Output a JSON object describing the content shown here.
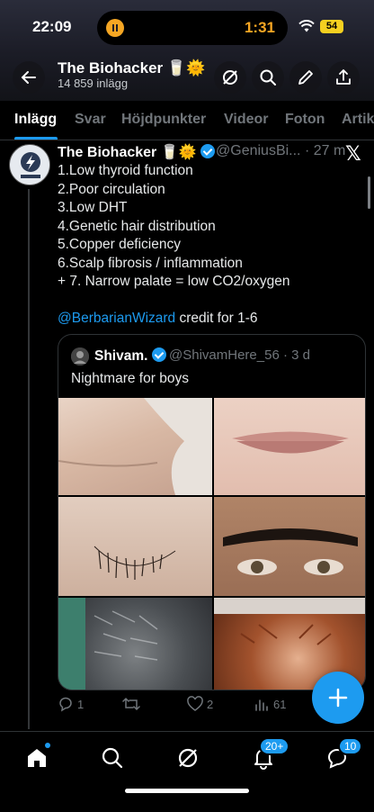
{
  "status_bar": {
    "time": "22:09",
    "timer": "1:31",
    "battery": "54"
  },
  "header": {
    "title": "The Biohacker 🥛🌞",
    "subtitle": "14 859 inlägg"
  },
  "tabs": [
    "Inlägg",
    "Svar",
    "Höjdpunkter",
    "Videor",
    "Foton",
    "Artik"
  ],
  "post": {
    "author_name": "The Biohacker 🥛🌞",
    "author_handle": "@GeniusBi... · 27 m",
    "lines": [
      "1.Low thyroid function",
      "2.Poor circulation",
      "3.Low DHT",
      "4.Genetic hair distribution",
      "5.Copper deficiency",
      "6.Scalp fibrosis / inflammation",
      "+ 7. Narrow palate = low CO2/oxygen"
    ],
    "mention": "@BerbarianWizard",
    "credit_text": " credit for 1-6",
    "quote": {
      "name": "Shivam.",
      "handle": "@ShivamHere_56 · 3 d",
      "text": "Nightmare for boys",
      "images": [
        "chin-stubble-photo",
        "upper-lip-photo",
        "armpit-hair-photo",
        "unibrow-photo",
        "gray-hair-photo",
        "thinning-scalp-photo"
      ]
    },
    "actions": {
      "replies": "1",
      "retweets": "",
      "likes": "2",
      "views": "61"
    }
  },
  "bottom_nav": {
    "notifications_badge": "20+",
    "messages_badge": "10"
  },
  "colors": {
    "accent": "#1d9bf0",
    "background": "#000000",
    "muted": "#71767b"
  }
}
